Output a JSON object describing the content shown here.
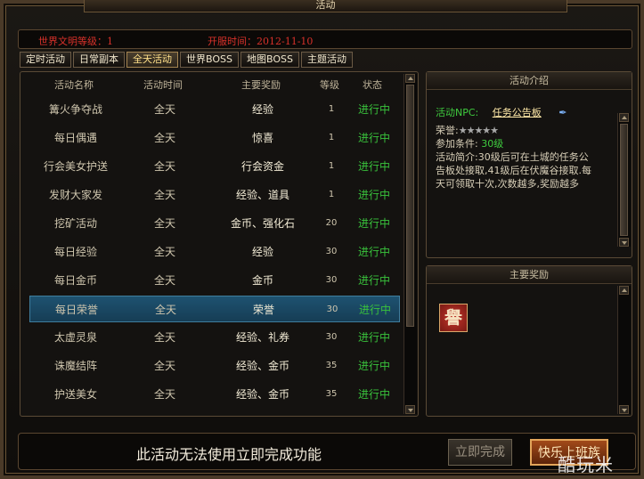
{
  "window": {
    "title": "活动"
  },
  "info": {
    "civ_level_label": "世界文明等级：1",
    "server_open_label": "开服时间：2012-11-10"
  },
  "tabs": [
    {
      "label": "定时活动"
    },
    {
      "label": "日常副本"
    },
    {
      "label": "全天活动"
    },
    {
      "label": "世界BOSS"
    },
    {
      "label": "地图BOSS"
    },
    {
      "label": "主题活动"
    }
  ],
  "active_tab": "全天活动",
  "list": {
    "headers": [
      "活动名称",
      "活动时间",
      "主要奖励",
      "等级",
      "状态"
    ],
    "rows": [
      {
        "name": "篝火争夺战",
        "time": "全天",
        "reward": "经验",
        "level": "1",
        "status": "进行中"
      },
      {
        "name": "每日偶遇",
        "time": "全天",
        "reward": "惊喜",
        "level": "1",
        "status": "进行中"
      },
      {
        "name": "行会美女护送",
        "time": "全天",
        "reward": "行会资金",
        "level": "1",
        "status": "进行中"
      },
      {
        "name": "发财大家发",
        "time": "全天",
        "reward": "经验、道具",
        "level": "1",
        "status": "进行中"
      },
      {
        "name": "挖矿活动",
        "time": "全天",
        "reward": "金币、强化石",
        "level": "20",
        "status": "进行中"
      },
      {
        "name": "每日经验",
        "time": "全天",
        "reward": "经验",
        "level": "30",
        "status": "进行中"
      },
      {
        "name": "每日金币",
        "time": "全天",
        "reward": "金币",
        "level": "30",
        "status": "进行中"
      },
      {
        "name": "每日荣誉",
        "time": "全天",
        "reward": "荣誉",
        "level": "30",
        "status": "进行中"
      },
      {
        "name": "太虚灵泉",
        "time": "全天",
        "reward": "经验、礼券",
        "level": "30",
        "status": "进行中"
      },
      {
        "name": "诛魔结阵",
        "time": "全天",
        "reward": "经验、金币",
        "level": "35",
        "status": "进行中"
      },
      {
        "name": "护送美女",
        "time": "全天",
        "reward": "经验、金币",
        "level": "35",
        "status": "进行中"
      }
    ],
    "selected_row": "每日荣誉"
  },
  "intro": {
    "title": "活动介绍",
    "npc_label": "活动NPC:",
    "npc_name": "任务公告板",
    "honor_label": "荣誉:",
    "stars": "★★★★★",
    "condition_label": "参加条件:",
    "condition_value": "30级",
    "desc_line1": "活动简介:30级后可在土城的任务公",
    "desc_line2": "告板处接取,41级后在伏魔谷接取.每",
    "desc_line3": "天可领取十次,次数越多,奖励越多"
  },
  "rewards": {
    "title": "主要奖励",
    "icon_char": "譽"
  },
  "bottom": {
    "message": "此活动无法使用立即完成功能",
    "complete_label": "立即完成",
    "happy_label": "快乐上班族"
  },
  "watermark": "酷玩米"
}
